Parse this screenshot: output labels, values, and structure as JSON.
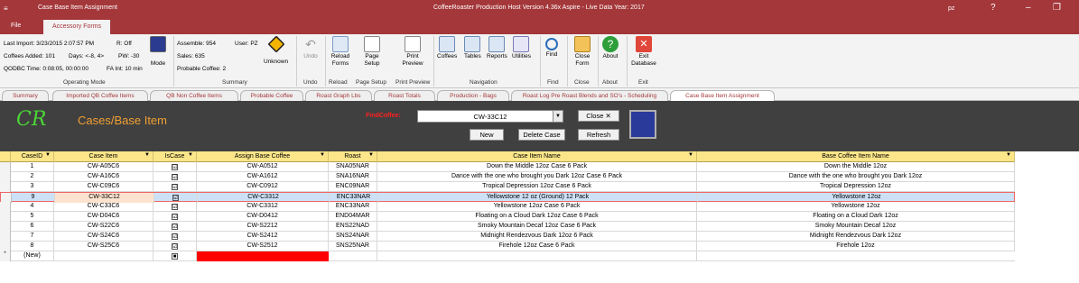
{
  "titlebar": {
    "quick_access": "≡",
    "left_title": "Case Base Item Assignment",
    "title": "CoffeeRoaster Production Host Version 4.36x  Aspire  - Live Data   Year: 2017",
    "user": "pz",
    "help": "?",
    "minimize": "–",
    "restore": "❐"
  },
  "ribbon_tabs": [
    "File",
    "Accessory Forms"
  ],
  "ribbon": {
    "info_lines": [
      "Last Import: 3/23/2015 2:07:57 PM",
      "R: Off",
      "Coffees Added: 101",
      "Days: <-8, 4>",
      "PW: -30",
      "QODBC Time: 0:08:05, 00:00:00",
      "FA Int: 10 min"
    ],
    "mode_label": "Mode",
    "assemble": "Assemble: 954",
    "user": "User: PZ",
    "sales": "Sales: 635",
    "probable": "Probable Coffee: 2",
    "unknown": "Unknown",
    "groups": {
      "operating_mode": "Operating Mode",
      "summary": "Summary",
      "undo": "Undo",
      "reload": "Reload",
      "page_setup": "Page Setup",
      "print_preview": "Print Preview",
      "navigation": "Navigation",
      "find": "Find",
      "close": "Close",
      "about": "About",
      "exit": "Exit"
    },
    "buttons": {
      "undo": "Undo",
      "reload": "Reload Forms",
      "page_setup": "Page Setup",
      "print": "Print Preview",
      "coffees": "Coffees",
      "tables": "Tables",
      "reports": "Reports",
      "utilities": "Utilities",
      "find": "Find",
      "close": "Close Form",
      "about": "About",
      "exit": "Exit Database"
    }
  },
  "object_tabs": [
    "Summary",
    "Imported QB Coffee Items",
    "QB Non Coffee Items",
    "Probable Coffee",
    "Roast Graph Lbs",
    "Roast Totals",
    "Production - Bags",
    "Roast Log Pre Roast Blends and SO's - Scheduling",
    "Case Base Item Assignment"
  ],
  "form": {
    "logo": "CR",
    "title": "Cases/Base Item",
    "find_label": "FindCoffee:",
    "find_value": "CW-33C12",
    "close_button": "Close ✕",
    "new_button": "New",
    "delete_button": "Delete Case",
    "refresh_button": "Refresh"
  },
  "table": {
    "columns": [
      "CaseID",
      "Case Item",
      "IsCase",
      "Assign Base Coffee",
      "Roast",
      "Case Item Name",
      "Base Coffee Item Name"
    ],
    "rows": [
      [
        "1",
        "CW-A05C6",
        "☑",
        "CW-A0512",
        "SNA05NAR",
        "Down the Middle 12oz Case 6 Pack",
        "Down the Middle 12oz"
      ],
      [
        "2",
        "CW-A16C6",
        "☑",
        "CW-A1612",
        "SNA16NAR",
        "Dance with the one who brought you Dark 12oz Case 6 Pack",
        "Dance with the one who brought you Dark 12oz"
      ],
      [
        "3",
        "CW-C09C6",
        "☑",
        "CW-C0912",
        "ENC09NAR",
        "Tropical Depression  12oz Case 6 Pack",
        "Tropical Depression  12oz"
      ],
      [
        "9",
        "CW-33C12",
        "☑",
        "CW-C3312",
        "ENC33NAR",
        "Yellowstone 12 oz (Ground) 12 Pack",
        "Yellowstone 12oz"
      ],
      [
        "4",
        "CW-C33C6",
        "☑",
        "CW-C3312",
        "ENC33NAR",
        "Yellowstone 12oz Case 6 Pack",
        "Yellowstone 12oz"
      ],
      [
        "5",
        "CW-D04C6",
        "☑",
        "CW-D0412",
        "END04MAR",
        "Floating on a Cloud Dark 12oz Case 6 Pack",
        "Floating on a Cloud Dark 12oz"
      ],
      [
        "6",
        "CW-S22C6",
        "☑",
        "CW-S2212",
        "ENS22NAD",
        "Smoky Mountain  Decaf 12oz Case 6 Pack",
        "Smoky Mountain  Decaf 12oz"
      ],
      [
        "7",
        "CW-S24C6",
        "☑",
        "CW-S2412",
        "SNS24NAR",
        "Midnight Rendezvous Dark 12oz 6 Pack",
        "Midnight Rendezvous Dark 12oz"
      ],
      [
        "8",
        "CW-S25C6",
        "☑",
        "CW-S2512",
        "SNS25NAR",
        "Firehole 12oz Case 6 Pack",
        "Firehole 12oz"
      ]
    ],
    "new_row_label": "(New)",
    "new_row_marker": "*",
    "selected_index": 3
  },
  "colors": {
    "accent": "#a4373a",
    "header_fill": "#fce689",
    "form_header": "#404040",
    "selected_row": "#cde1f6"
  }
}
